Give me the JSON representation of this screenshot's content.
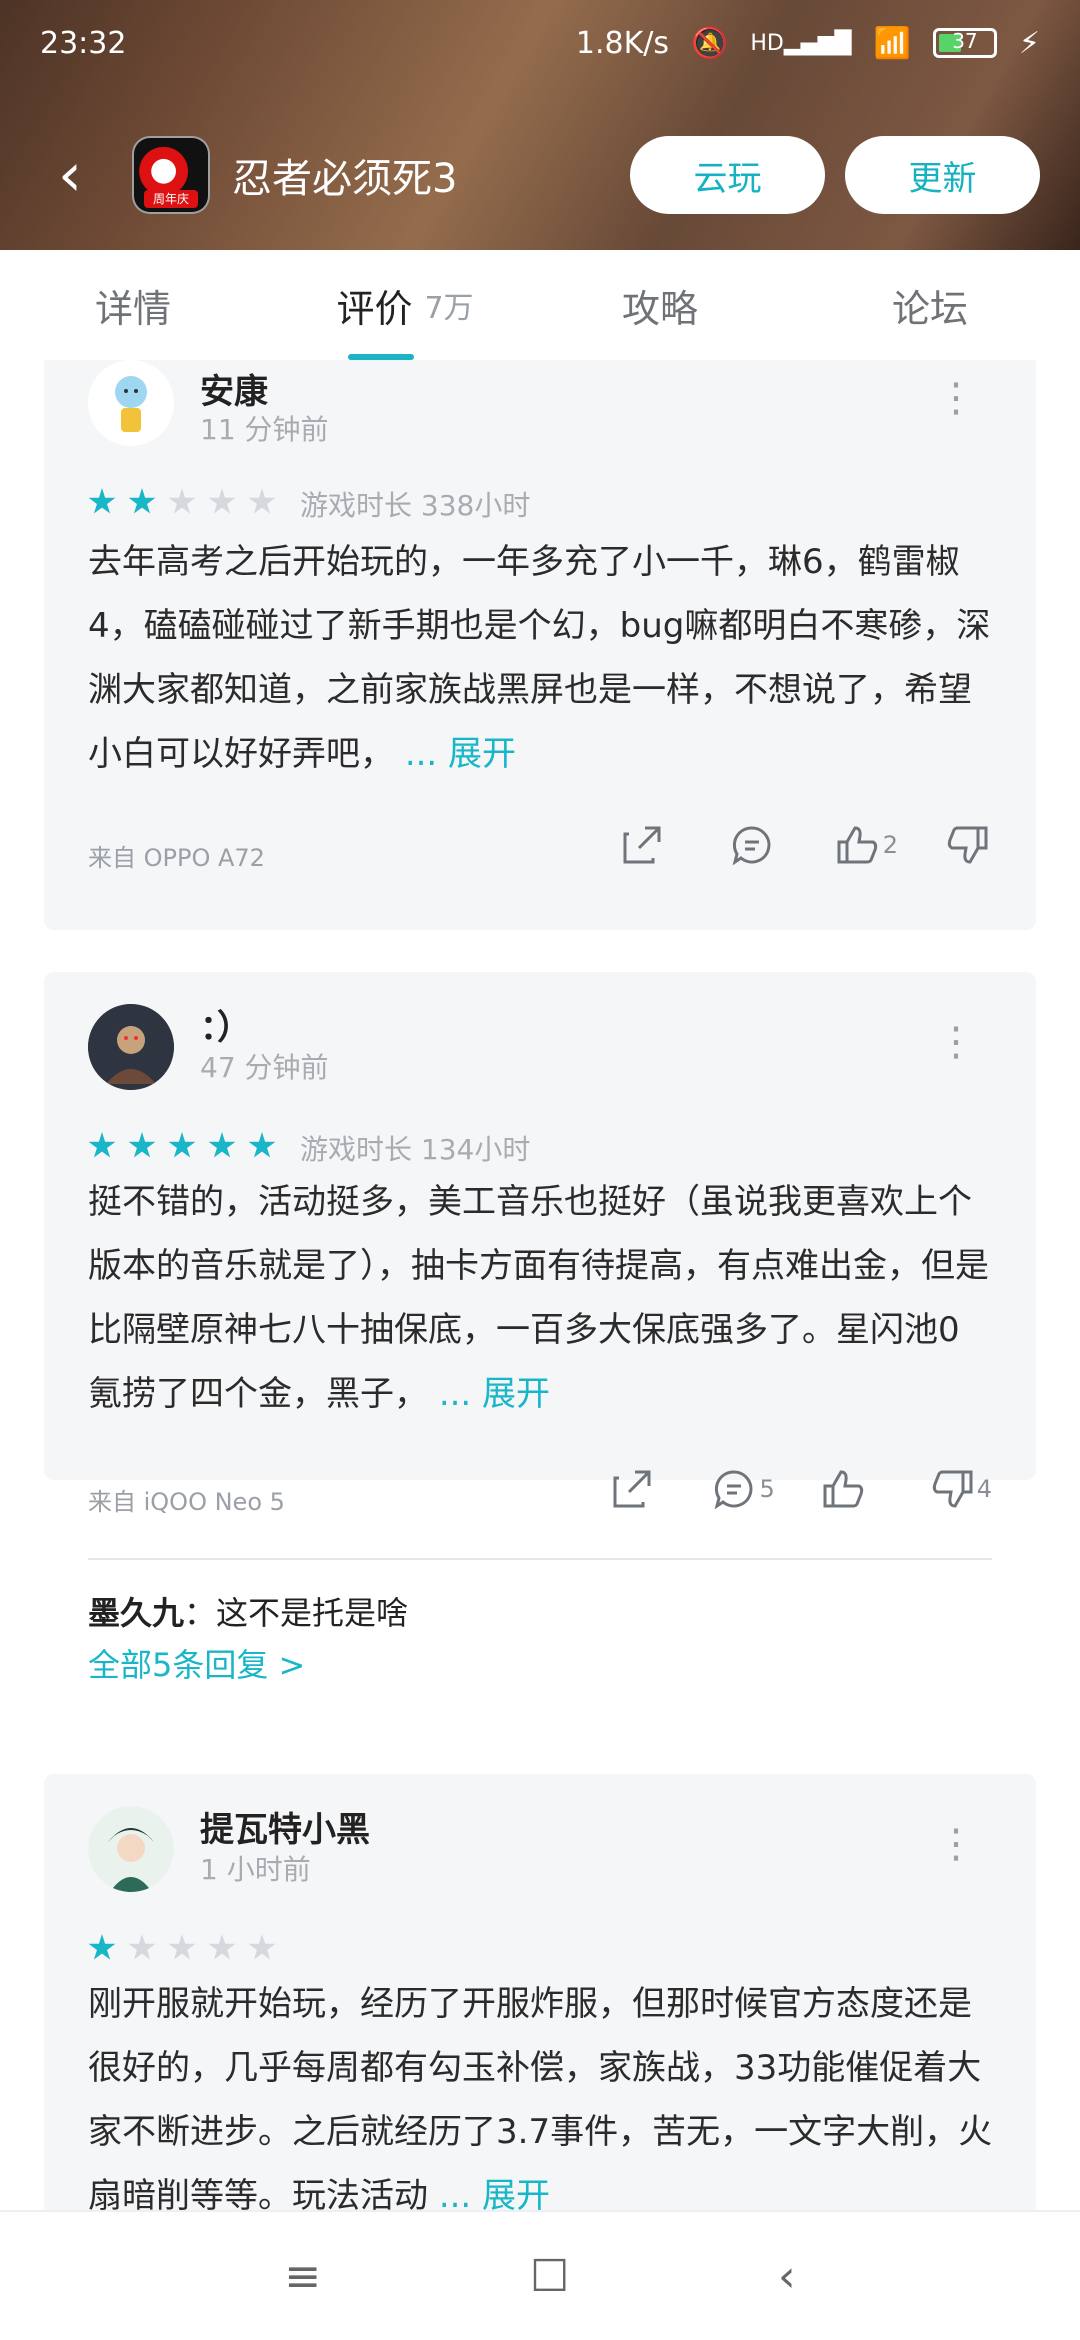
{
  "status": {
    "time": "23:32",
    "speed": "1.8K/s",
    "signal": "HD",
    "battery": "37"
  },
  "app": {
    "title": "忍者必须死3",
    "badge": "周年庆",
    "cloud_play": "云玩",
    "update": "更新"
  },
  "tabs": [
    {
      "label": "详情"
    },
    {
      "label": "评价",
      "count": "7万"
    },
    {
      "label": "攻略"
    },
    {
      "label": "论坛"
    }
  ],
  "reviews": [
    {
      "name": "安康",
      "time": "11 分钟前",
      "rating": 2,
      "playtime": "游戏时长 338小时",
      "text": "去年高考之后开始玩的，一年多充了小一千，琳6，鹤雷椒4，磕磕碰碰过了新手期也是个幻，bug嘛都明白不寒碜，深渊大家都知道，之前家族战黑屏也是一样，不想说了，希望小白可以好好弄吧，",
      "expand": "... 展开",
      "device": "来自 OPPO A72",
      "likes": "2"
    },
    {
      "name": "：）",
      "time": "47 分钟前",
      "rating": 5,
      "playtime": "游戏时长 134小时",
      "text": "挺不错的，活动挺多，美工音乐也挺好（虽说我更喜欢上个版本的音乐就是了），抽卡方面有待提高，有点难出金，但是比隔壁原神七八十抽保底，一百多大保底强多了。星闪池0氪捞了四个金，黑子，",
      "expand": "... 展开",
      "device": "来自 iQOO Neo 5",
      "comments": "5",
      "dislikes": "4",
      "reply_user": "墨久九",
      "reply_text": "：这不是托是啥",
      "all_replies": "全部5条回复 >"
    },
    {
      "name": "提瓦特小黑",
      "time": "1 小时前",
      "rating": 1,
      "text": "刚开服就开始玩，经历了开服炸服，但那时候官方态度还是很好的，几乎每周都有勾玉补偿，家族战，33功能催促着大家不断进步。之后就经历了3.7事件，苦无，一文字大削，火扇暗削等等。玩法活动",
      "expand": "... 展开"
    }
  ],
  "nav": {
    "menu": "≡",
    "home": "☐",
    "back": "‹"
  }
}
